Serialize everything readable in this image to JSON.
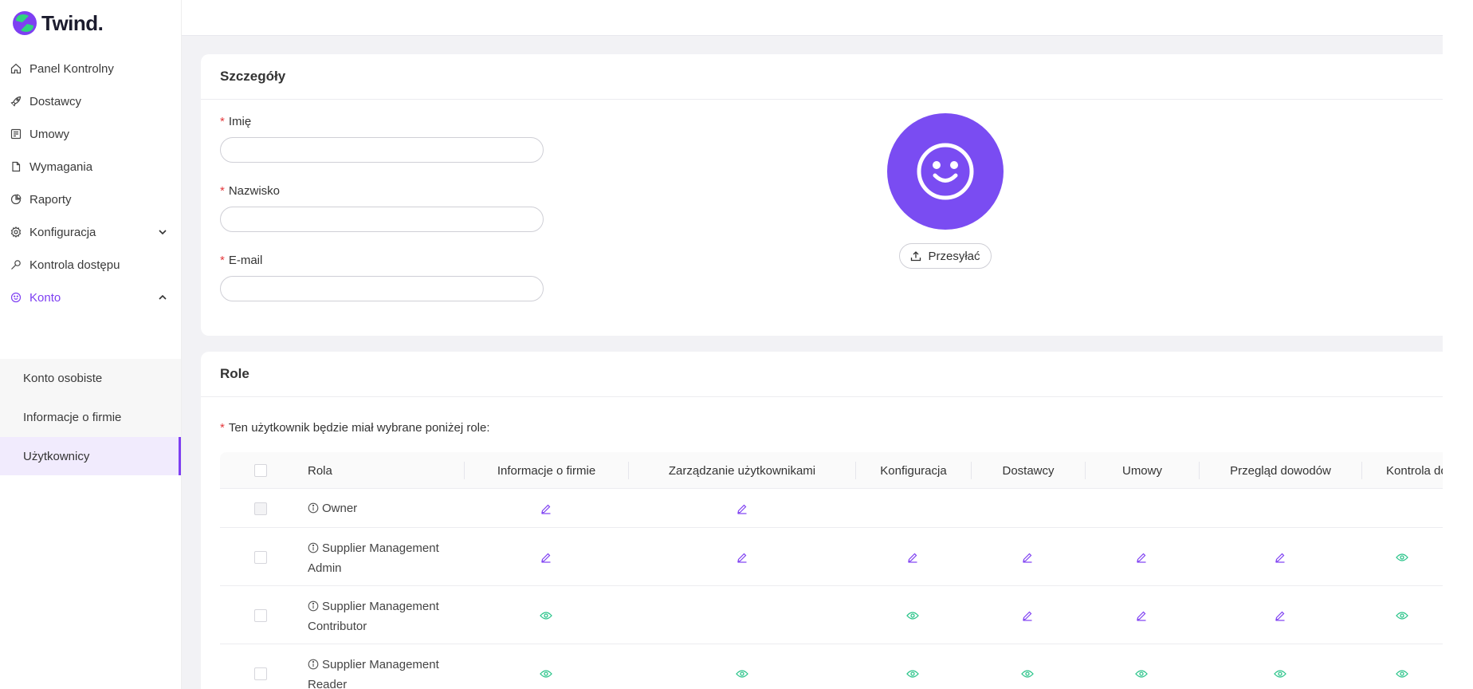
{
  "brand": {
    "name": "Twind.",
    "accent": "#7e3ff2",
    "logo_colors": [
      "#2fd47f",
      "#7e3ff2"
    ]
  },
  "sidebar": {
    "items": [
      {
        "label": "Panel Kontrolny",
        "icon": "home-icon"
      },
      {
        "label": "Dostawcy",
        "icon": "rocket-icon"
      },
      {
        "label": "Umowy",
        "icon": "contract-icon"
      },
      {
        "label": "Wymagania",
        "icon": "document-icon"
      },
      {
        "label": "Raporty",
        "icon": "pie-chart-icon"
      },
      {
        "label": "Konfiguracja",
        "icon": "gear-icon"
      },
      {
        "label": "Kontrola dostępu",
        "icon": "key-icon"
      },
      {
        "label": "Konto",
        "icon": "smiley-icon"
      }
    ],
    "subitems": [
      {
        "label": "Konto osobiste"
      },
      {
        "label": "Informacje o firmie"
      },
      {
        "label": "Użytkownicy"
      }
    ]
  },
  "details": {
    "title": "Szczegóły",
    "fields": [
      {
        "label": "Imię",
        "value": ""
      },
      {
        "label": "Nazwisko",
        "value": ""
      },
      {
        "label": "E-mail",
        "value": ""
      }
    ],
    "upload_label": "Przesyłać",
    "avatar_color": "#7a4cf2"
  },
  "roles": {
    "title": "Role",
    "note": "Ten użytkownik będzie miał wybrane poniżej role:",
    "columns": [
      "Rola",
      "Informacje o firmie",
      "Zarządzanie użytkownikami",
      "Konfiguracja",
      "Dostawcy",
      "Umowy",
      "Przegląd dowodów",
      "Kontrola dost"
    ],
    "rows": [
      {
        "name": "Owner",
        "checkbox_disabled": true,
        "perms": [
          "edit",
          "edit",
          "",
          "",
          "",
          "",
          ""
        ]
      },
      {
        "name": "Supplier Management Admin",
        "checkbox_disabled": false,
        "perms": [
          "edit",
          "edit",
          "edit",
          "edit",
          "edit",
          "edit",
          "view"
        ]
      },
      {
        "name": "Supplier Management Contributor",
        "checkbox_disabled": false,
        "perms": [
          "view",
          "",
          "view",
          "edit",
          "edit",
          "edit",
          "view"
        ]
      },
      {
        "name": "Supplier Management Reader",
        "checkbox_disabled": false,
        "perms": [
          "view",
          "view",
          "view",
          "view",
          "view",
          "view",
          "view"
        ]
      }
    ],
    "edit_color": "#7e3ff2",
    "view_color": "#2bc48a"
  }
}
